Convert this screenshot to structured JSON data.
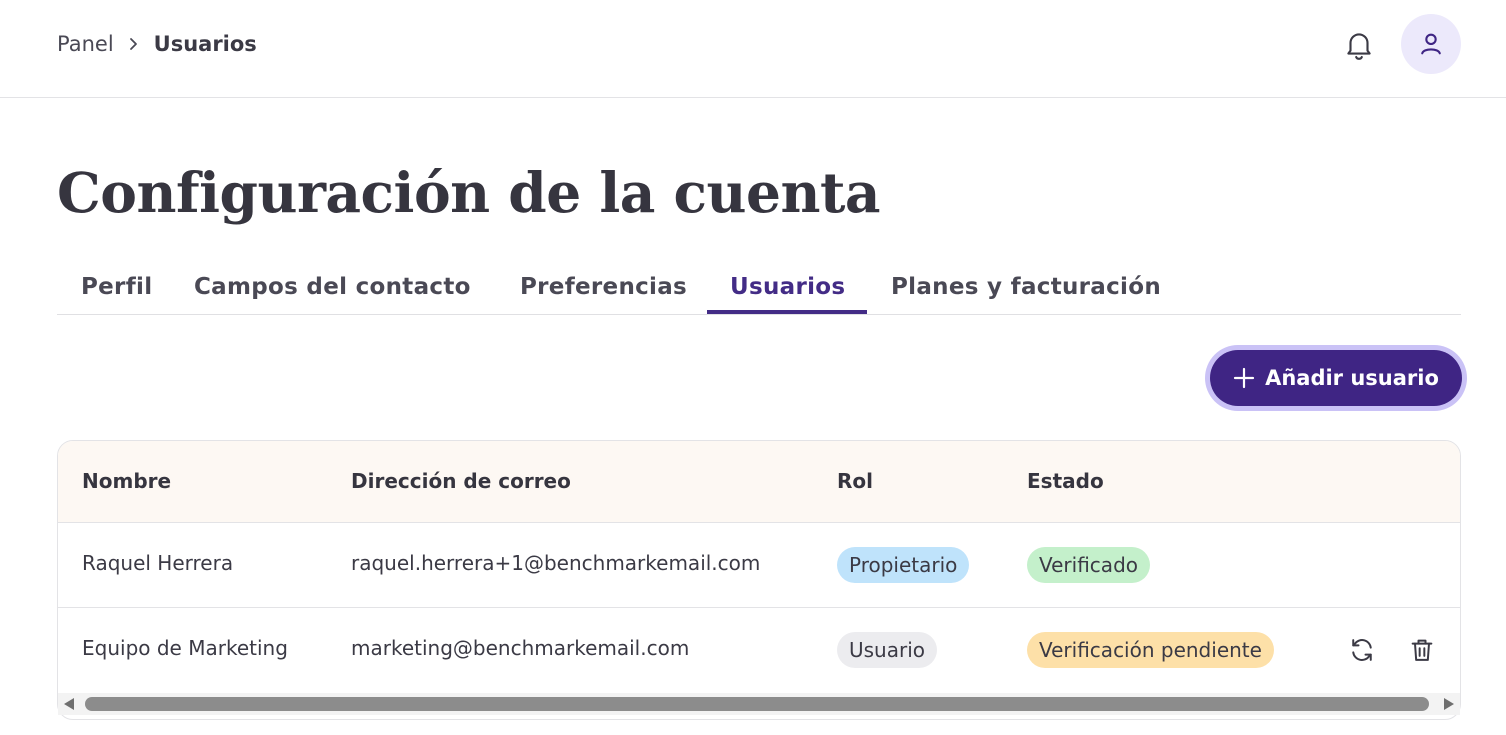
{
  "breadcrumb": {
    "parent": "Panel",
    "current": "Usuarios"
  },
  "header": {
    "notifications_icon": "bell-icon",
    "avatar_icon": "user-icon"
  },
  "page": {
    "title": "Configuración de la cuenta"
  },
  "tabs": [
    {
      "label": "Perfil",
      "active": false
    },
    {
      "label": "Campos del contacto",
      "active": false
    },
    {
      "label": "Preferencias",
      "active": false
    },
    {
      "label": "Usuarios",
      "active": true
    },
    {
      "label": "Planes y facturación",
      "active": false
    }
  ],
  "actions": {
    "add_user_label": "Añadir usuario",
    "add_icon": "plus-icon"
  },
  "table": {
    "headers": {
      "name": "Nombre",
      "email": "Dirección de correo",
      "role": "Rol",
      "status": "Estado"
    },
    "rows": [
      {
        "name": "Raquel Herrera",
        "email": "raquel.herrera+1@benchmarkemail.com",
        "role": "Propietario",
        "status": "Verificado",
        "actions": []
      },
      {
        "name": "Equipo de Marketing",
        "email": "marketing@benchmarkemail.com",
        "role": "Usuario",
        "status": "Verificación pendiente",
        "actions": [
          "refresh-icon",
          "trash-icon"
        ]
      }
    ]
  },
  "colors": {
    "accent": "#432c86",
    "button_bg": "#3f2584",
    "button_ring": "#cac2f6",
    "header_bg": "#fdf8f3",
    "role_owner": "#bfe3fb",
    "status_verified": "#c4f0cb",
    "role_user": "#ececef",
    "status_pending": "#fde0a8"
  }
}
